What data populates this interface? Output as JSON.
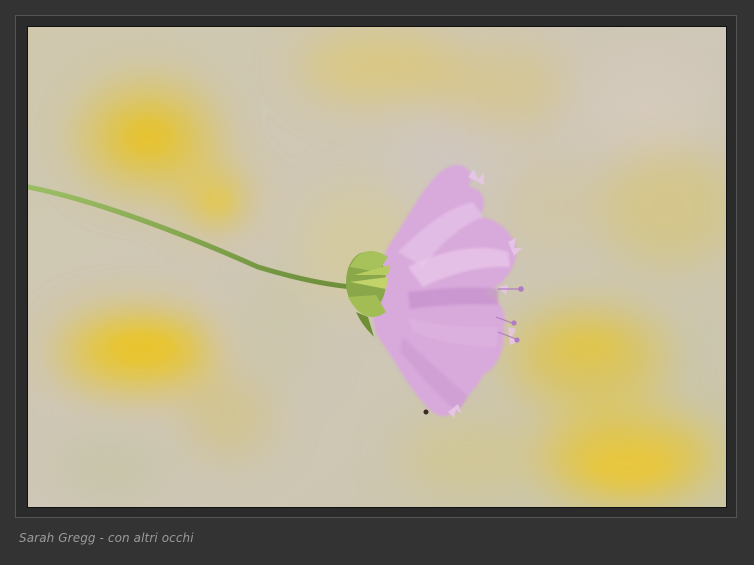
{
  "caption": {
    "text": "Sarah Gregg - con altri occhi"
  },
  "photo": {
    "subject": "pink-flower-on-stem",
    "colors": {
      "frame_bg": "#333333",
      "background_soft": "#c9c2a8",
      "blur_yellow": "#e5c53a",
      "stem_green": "#7f9f4a",
      "petal_pink": "#d7a6da",
      "petal_shadow": "#b27ebd"
    }
  }
}
